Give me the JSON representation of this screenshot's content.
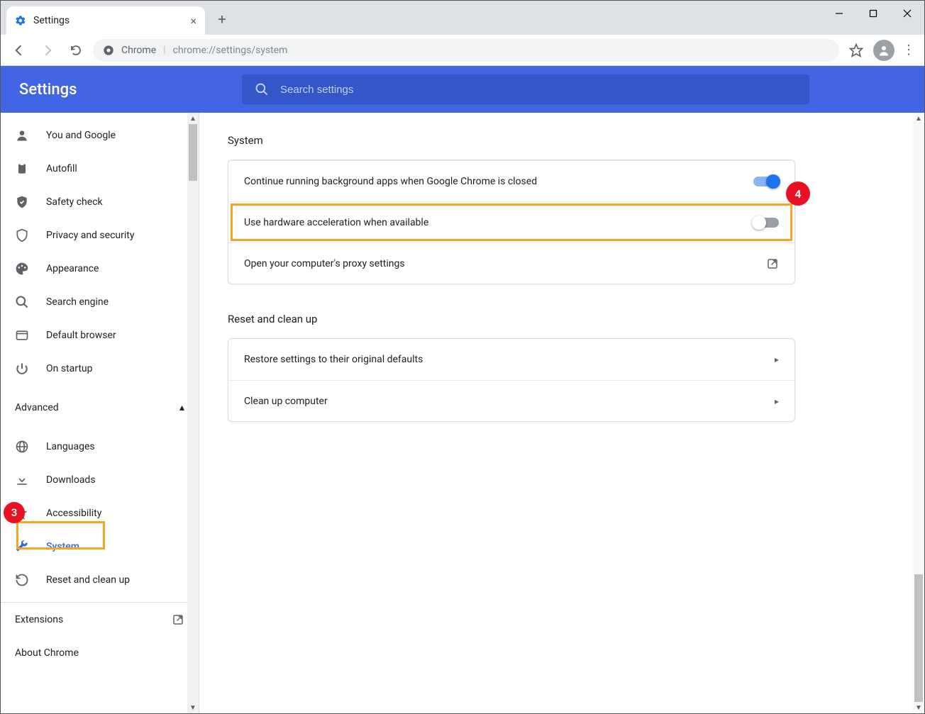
{
  "window": {
    "tab_title": "Settings",
    "minimize_tip": "Minimize",
    "maximize_tip": "Maximize",
    "close_tip": "Close"
  },
  "toolbar": {
    "chrome_label": "Chrome",
    "url_path": "chrome://settings/system"
  },
  "header": {
    "title": "Settings",
    "search_placeholder": "Search settings"
  },
  "sidebar": {
    "items_basic": [
      {
        "icon": "person",
        "label": "You and Google"
      },
      {
        "icon": "clipboard",
        "label": "Autofill"
      },
      {
        "icon": "shield-check",
        "label": "Safety check"
      },
      {
        "icon": "shield",
        "label": "Privacy and security"
      },
      {
        "icon": "palette",
        "label": "Appearance"
      },
      {
        "icon": "search",
        "label": "Search engine"
      },
      {
        "icon": "browser",
        "label": "Default browser"
      },
      {
        "icon": "power",
        "label": "On startup"
      }
    ],
    "advanced_label": "Advanced",
    "items_advanced": [
      {
        "icon": "globe",
        "label": "Languages"
      },
      {
        "icon": "download",
        "label": "Downloads"
      },
      {
        "icon": "accessibility",
        "label": "Accessibility"
      },
      {
        "icon": "wrench",
        "label": "System",
        "active": true
      },
      {
        "icon": "restore",
        "label": "Reset and clean up"
      }
    ],
    "footer": [
      {
        "label": "Extensions",
        "external": true
      },
      {
        "label": "About Chrome"
      }
    ]
  },
  "main": {
    "section1_title": "System",
    "rows1": [
      {
        "label": "Continue running background apps when Google Chrome is closed",
        "toggle": "on"
      },
      {
        "label": "Use hardware acceleration when available",
        "toggle": "off",
        "highlight": true
      },
      {
        "label": "Open your computer's proxy settings",
        "action": "external"
      }
    ],
    "section2_title": "Reset and clean up",
    "rows2": [
      {
        "label": "Restore settings to their original defaults",
        "action": "chevron"
      },
      {
        "label": "Clean up computer",
        "action": "chevron"
      }
    ]
  },
  "annotations": {
    "badge3": "3",
    "badge4": "4"
  }
}
